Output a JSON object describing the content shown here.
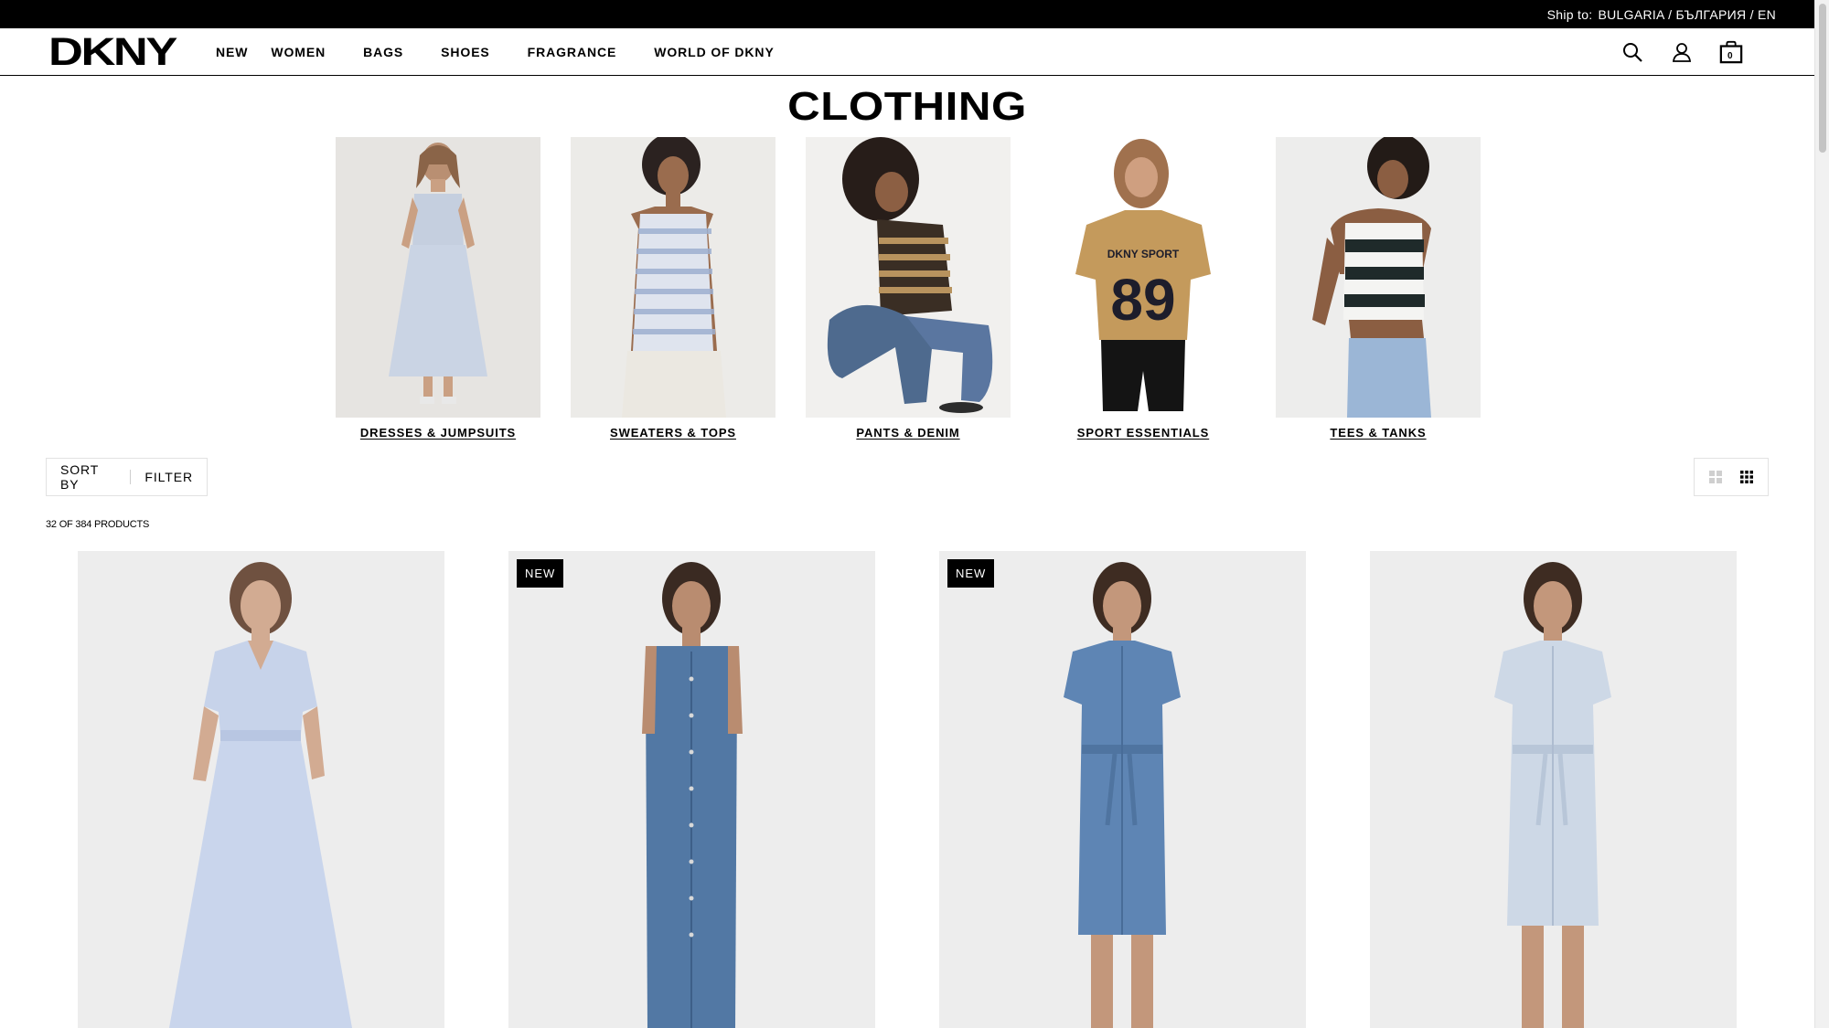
{
  "ship_bar": {
    "label": "Ship to:",
    "value": "BULGARIA / БЪЛГАРИЯ / EN"
  },
  "header": {
    "logo": "DKNY",
    "nav": [
      "NEW",
      "WOMEN",
      "BAGS",
      "SHOES",
      "FRAGRANCE",
      "WORLD OF DKNY"
    ],
    "cart_count": "0"
  },
  "page": {
    "title": "CLOTHING"
  },
  "categories": [
    {
      "label": "DRESSES & JUMPSUITS"
    },
    {
      "label": "SWEATERS & TOPS"
    },
    {
      "label": "PANTS & DENIM"
    },
    {
      "label": "SPORT ESSENTIALS"
    },
    {
      "label": "TEES & TANKS"
    }
  ],
  "sport_tee": {
    "brand": "DKNY SPORT",
    "number": "89"
  },
  "toolbar": {
    "sort_label": "SORT BY",
    "filter_label": "FILTER"
  },
  "product_count": "32 OF 384 PRODUCTS",
  "products": [
    {
      "badge": ""
    },
    {
      "badge": "NEW"
    },
    {
      "badge": "NEW"
    },
    {
      "badge": ""
    }
  ],
  "colors": {
    "accent": "#000000",
    "background": "#ffffff",
    "product_bg": "#ededed"
  }
}
